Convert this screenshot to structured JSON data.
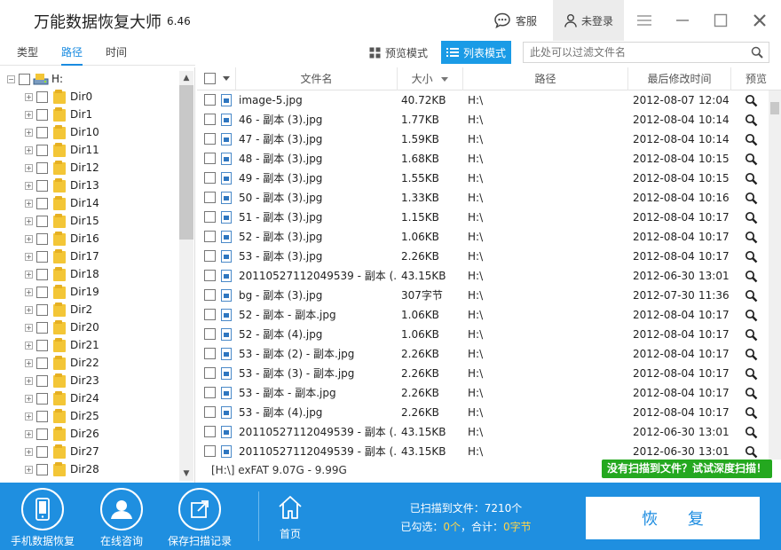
{
  "app": {
    "title": "万能数据恢复大师",
    "version": "6.46"
  },
  "topbar": {
    "service_label": "客服",
    "login_label": "未登录"
  },
  "tabs": [
    {
      "label": "类型"
    },
    {
      "label": "路径"
    },
    {
      "label": "时间"
    }
  ],
  "view": {
    "preview_label": "预览模式",
    "list_label": "列表模式"
  },
  "search": {
    "placeholder": "此处可以过滤文件名"
  },
  "tree": {
    "root": "H:",
    "items": [
      "Dir0",
      "Dir1",
      "Dir10",
      "Dir11",
      "Dir12",
      "Dir13",
      "Dir14",
      "Dir15",
      "Dir16",
      "Dir17",
      "Dir18",
      "Dir19",
      "Dir2",
      "Dir20",
      "Dir21",
      "Dir22",
      "Dir23",
      "Dir24",
      "Dir25",
      "Dir26",
      "Dir27",
      "Dir28"
    ]
  },
  "table": {
    "headers": {
      "name": "文件名",
      "size": "大小",
      "path": "路径",
      "modified": "最后修改时间",
      "preview": "预览"
    },
    "rows": [
      {
        "name": "image-5.jpg",
        "size": "40.72KB",
        "path": "H:\\",
        "date": "2012-08-07",
        "time": "12:04"
      },
      {
        "name": "46 - 副本 (3).jpg",
        "size": "1.77KB",
        "path": "H:\\",
        "date": "2012-08-04",
        "time": "10:14"
      },
      {
        "name": "47 - 副本 (3).jpg",
        "size": "1.59KB",
        "path": "H:\\",
        "date": "2012-08-04",
        "time": "10:14"
      },
      {
        "name": "48 - 副本 (3).jpg",
        "size": "1.68KB",
        "path": "H:\\",
        "date": "2012-08-04",
        "time": "10:15"
      },
      {
        "name": "49 - 副本 (3).jpg",
        "size": "1.55KB",
        "path": "H:\\",
        "date": "2012-08-04",
        "time": "10:15"
      },
      {
        "name": "50 - 副本 (3).jpg",
        "size": "1.33KB",
        "path": "H:\\",
        "date": "2012-08-04",
        "time": "10:16"
      },
      {
        "name": "51 - 副本 (3).jpg",
        "size": "1.15KB",
        "path": "H:\\",
        "date": "2012-08-04",
        "time": "10:17"
      },
      {
        "name": "52 - 副本 (3).jpg",
        "size": "1.06KB",
        "path": "H:\\",
        "date": "2012-08-04",
        "time": "10:17"
      },
      {
        "name": "53 - 副本 (3).jpg",
        "size": "2.26KB",
        "path": "H:\\",
        "date": "2012-08-04",
        "time": "10:17"
      },
      {
        "name": "20110527112049539 - 副本 (...",
        "size": "43.15KB",
        "path": "H:\\",
        "date": "2012-06-30",
        "time": "13:01"
      },
      {
        "name": "bg - 副本 (3).jpg",
        "size": "307字节",
        "path": "H:\\",
        "date": "2012-07-30",
        "time": "11:36"
      },
      {
        "name": "52 - 副本 - 副本.jpg",
        "size": "1.06KB",
        "path": "H:\\",
        "date": "2012-08-04",
        "time": "10:17"
      },
      {
        "name": "52 - 副本 (4).jpg",
        "size": "1.06KB",
        "path": "H:\\",
        "date": "2012-08-04",
        "time": "10:17"
      },
      {
        "name": "53 - 副本 (2) - 副本.jpg",
        "size": "2.26KB",
        "path": "H:\\",
        "date": "2012-08-04",
        "time": "10:17"
      },
      {
        "name": "53 - 副本 (3) - 副本.jpg",
        "size": "2.26KB",
        "path": "H:\\",
        "date": "2012-08-04",
        "time": "10:17"
      },
      {
        "name": "53 - 副本 - 副本.jpg",
        "size": "2.26KB",
        "path": "H:\\",
        "date": "2012-08-04",
        "time": "10:17"
      },
      {
        "name": "53 - 副本 (4).jpg",
        "size": "2.26KB",
        "path": "H:\\",
        "date": "2012-08-04",
        "time": "10:17"
      },
      {
        "name": "20110527112049539 - 副本 (...",
        "size": "43.15KB",
        "path": "H:\\",
        "date": "2012-06-30",
        "time": "13:01"
      },
      {
        "name": "20110527112049539 - 副本 (...",
        "size": "43.15KB",
        "path": "H:\\",
        "date": "2012-06-30",
        "time": "13:01"
      }
    ]
  },
  "status": {
    "drive_info": "[H:\\] exFAT 9.07G - 9.99G",
    "deep_scan_label": "没有扫描到文件？试试深度扫描！"
  },
  "footer": {
    "buttons": [
      {
        "label": "手机数据恢复"
      },
      {
        "label": "在线咨询"
      },
      {
        "label": "保存扫描记录"
      }
    ],
    "home_label": "首页",
    "scanned_prefix": "已扫描到文件：",
    "scanned_count": "7210个",
    "selected_prefix": "已勾选：",
    "selected_count": "0个",
    "total_prefix": "，合计：",
    "total_size": "0字节",
    "restore_label": "恢 复"
  },
  "colors": {
    "accent": "#1a8be0",
    "footer_bg": "#1f8fe0",
    "deep_scan_bg": "#24a81f",
    "highlight": "#ffd54a"
  }
}
